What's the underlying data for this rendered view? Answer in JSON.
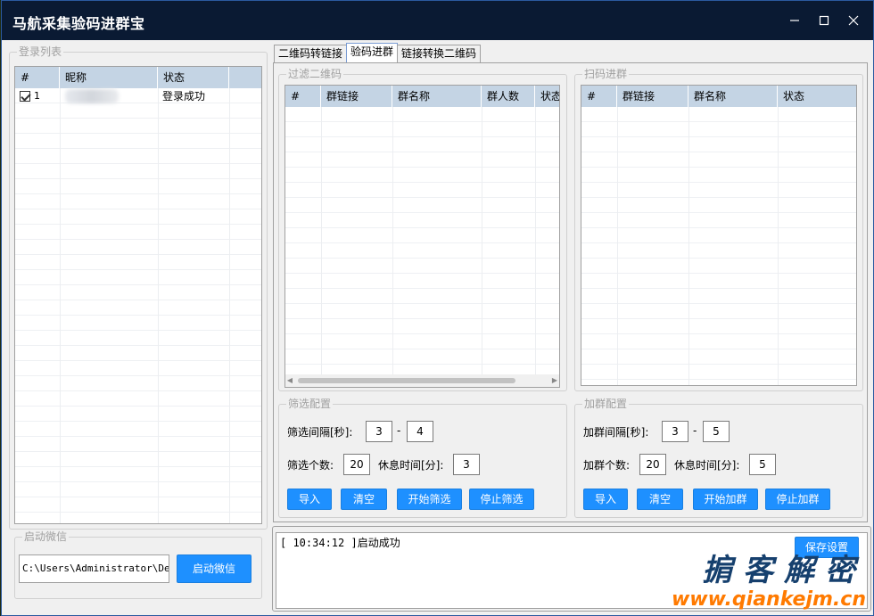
{
  "window": {
    "title": "马航采集验码进群宝",
    "controls": {
      "minimize": "minimize-icon",
      "maximize": "maximize-icon",
      "close": "close-icon"
    }
  },
  "login_list": {
    "label": "登录列表",
    "columns": [
      "#",
      "昵称",
      "状态"
    ],
    "rows": [
      {
        "index": "1",
        "checked": true,
        "status": "登录成功"
      }
    ]
  },
  "launch_wechat": {
    "label": "启动微信",
    "path_value": "C:\\Users\\Administrator\\Desktop",
    "button": "启动微信"
  },
  "tabs": [
    {
      "label": "二维码转链接",
      "active": false
    },
    {
      "label": "验码进群",
      "active": true
    },
    {
      "label": "链接转换二维码",
      "active": false
    }
  ],
  "filter_qr": {
    "label": "过滤二维码",
    "columns": [
      "#",
      "群链接",
      "群名称",
      "群人数",
      "状态"
    ]
  },
  "scan_join": {
    "label": "扫码进群",
    "columns": [
      "#",
      "群链接",
      "群名称",
      "状态"
    ]
  },
  "filter_config": {
    "label": "筛选配置",
    "interval_label": "筛选间隔[秒]:",
    "interval_min": "3",
    "interval_max": "4",
    "count_label": "筛选个数:",
    "count_value": "20",
    "rest_label": "休息时间[分]:",
    "rest_value": "3",
    "buttons": {
      "import": "导入",
      "clear": "清空",
      "start": "开始筛选",
      "stop": "停止筛选"
    }
  },
  "join_config": {
    "label": "加群配置",
    "interval_label": "加群间隔[秒]:",
    "interval_min": "3",
    "interval_max": "5",
    "count_label": "加群个数:",
    "count_value": "20",
    "rest_label": "休息时间[分]:",
    "rest_value": "5",
    "buttons": {
      "import": "导入",
      "clear": "清空",
      "start": "开始加群",
      "stop": "停止加群"
    }
  },
  "dash": "-",
  "log": {
    "lines": [
      "[ 10:34:12 ]启动成功"
    ],
    "save_button": "保存设置"
  },
  "watermark": {
    "title": "掮客解密",
    "url": "www.qiankejm.cn"
  },
  "colors": {
    "titlebar": "#0a1a33",
    "accent_button": "#1e90ff",
    "grid_header": "#c4d4e4",
    "watermark_title": "#16406e",
    "watermark_url": "#ff7a00"
  }
}
